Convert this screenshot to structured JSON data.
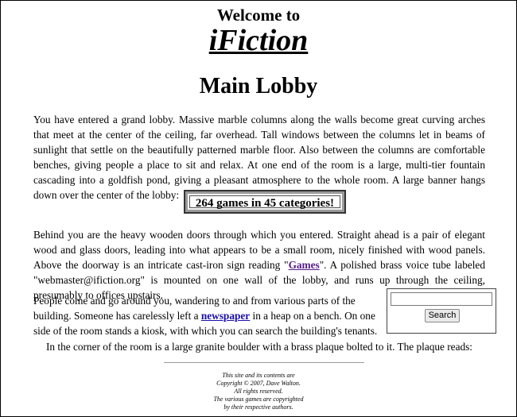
{
  "header": {
    "welcome": "Welcome to",
    "site_name": "iFiction",
    "page_title": "Main Lobby"
  },
  "intro_paragraph": "You have entered a grand lobby. Massive marble columns along the walls become great curving arches that meet at the center of the ceiling, far overhead. Tall windows between the columns let in beams of sunlight that settle on the beautifully patterned marble floor. Also between the columns are comfortable benches, giving people a place to sit and relax. At one end of the room is a large, multi-tier fountain cascading into a goldfish pond, giving a pleasant atmosphere to the whole room. A large banner hangs down over the center of the lobby:",
  "banner": {
    "text": "264 games in 45 categories!"
  },
  "doors_paragraph": {
    "before": "Behind you are the heavy wooden doors through which you entered. Straight ahead is a pair of elegant wood and glass doors, leading into what appears to be a small room, nicely finished with wood panels. Above the doorway is an intricate cast-iron sign reading \"",
    "link": "Games",
    "after": "\". A polished brass voice tube labeled \"webmaster@ifiction.org\" is mounted on one wall of the lobby, and runs up through the ceiling, presumably to offices upstairs."
  },
  "people_paragraph": {
    "before": "People come and go around you, wandering to and from various parts of the building. Someone has carelessly left a ",
    "link": "newspaper",
    "after": " in a heap on a bench. On one side of the room stands a kiosk, with which you can search the building's tenants."
  },
  "search": {
    "value": "",
    "placeholder": "",
    "button_label": "Search"
  },
  "corner_paragraph": "In the corner of the room is a large granite boulder with a brass plaque bolted to it. The plaque reads:",
  "footer": {
    "line1": "This site and its contents are",
    "line2": "Copyright © 2007, Dave Walton.",
    "line3": "All rights reserved.",
    "line4": "The various games are copyrighted",
    "line5": "by their respective authors."
  },
  "colors": {
    "link": "#1a0dab",
    "visited_link": "#551a8b",
    "background": "#ffffff"
  }
}
